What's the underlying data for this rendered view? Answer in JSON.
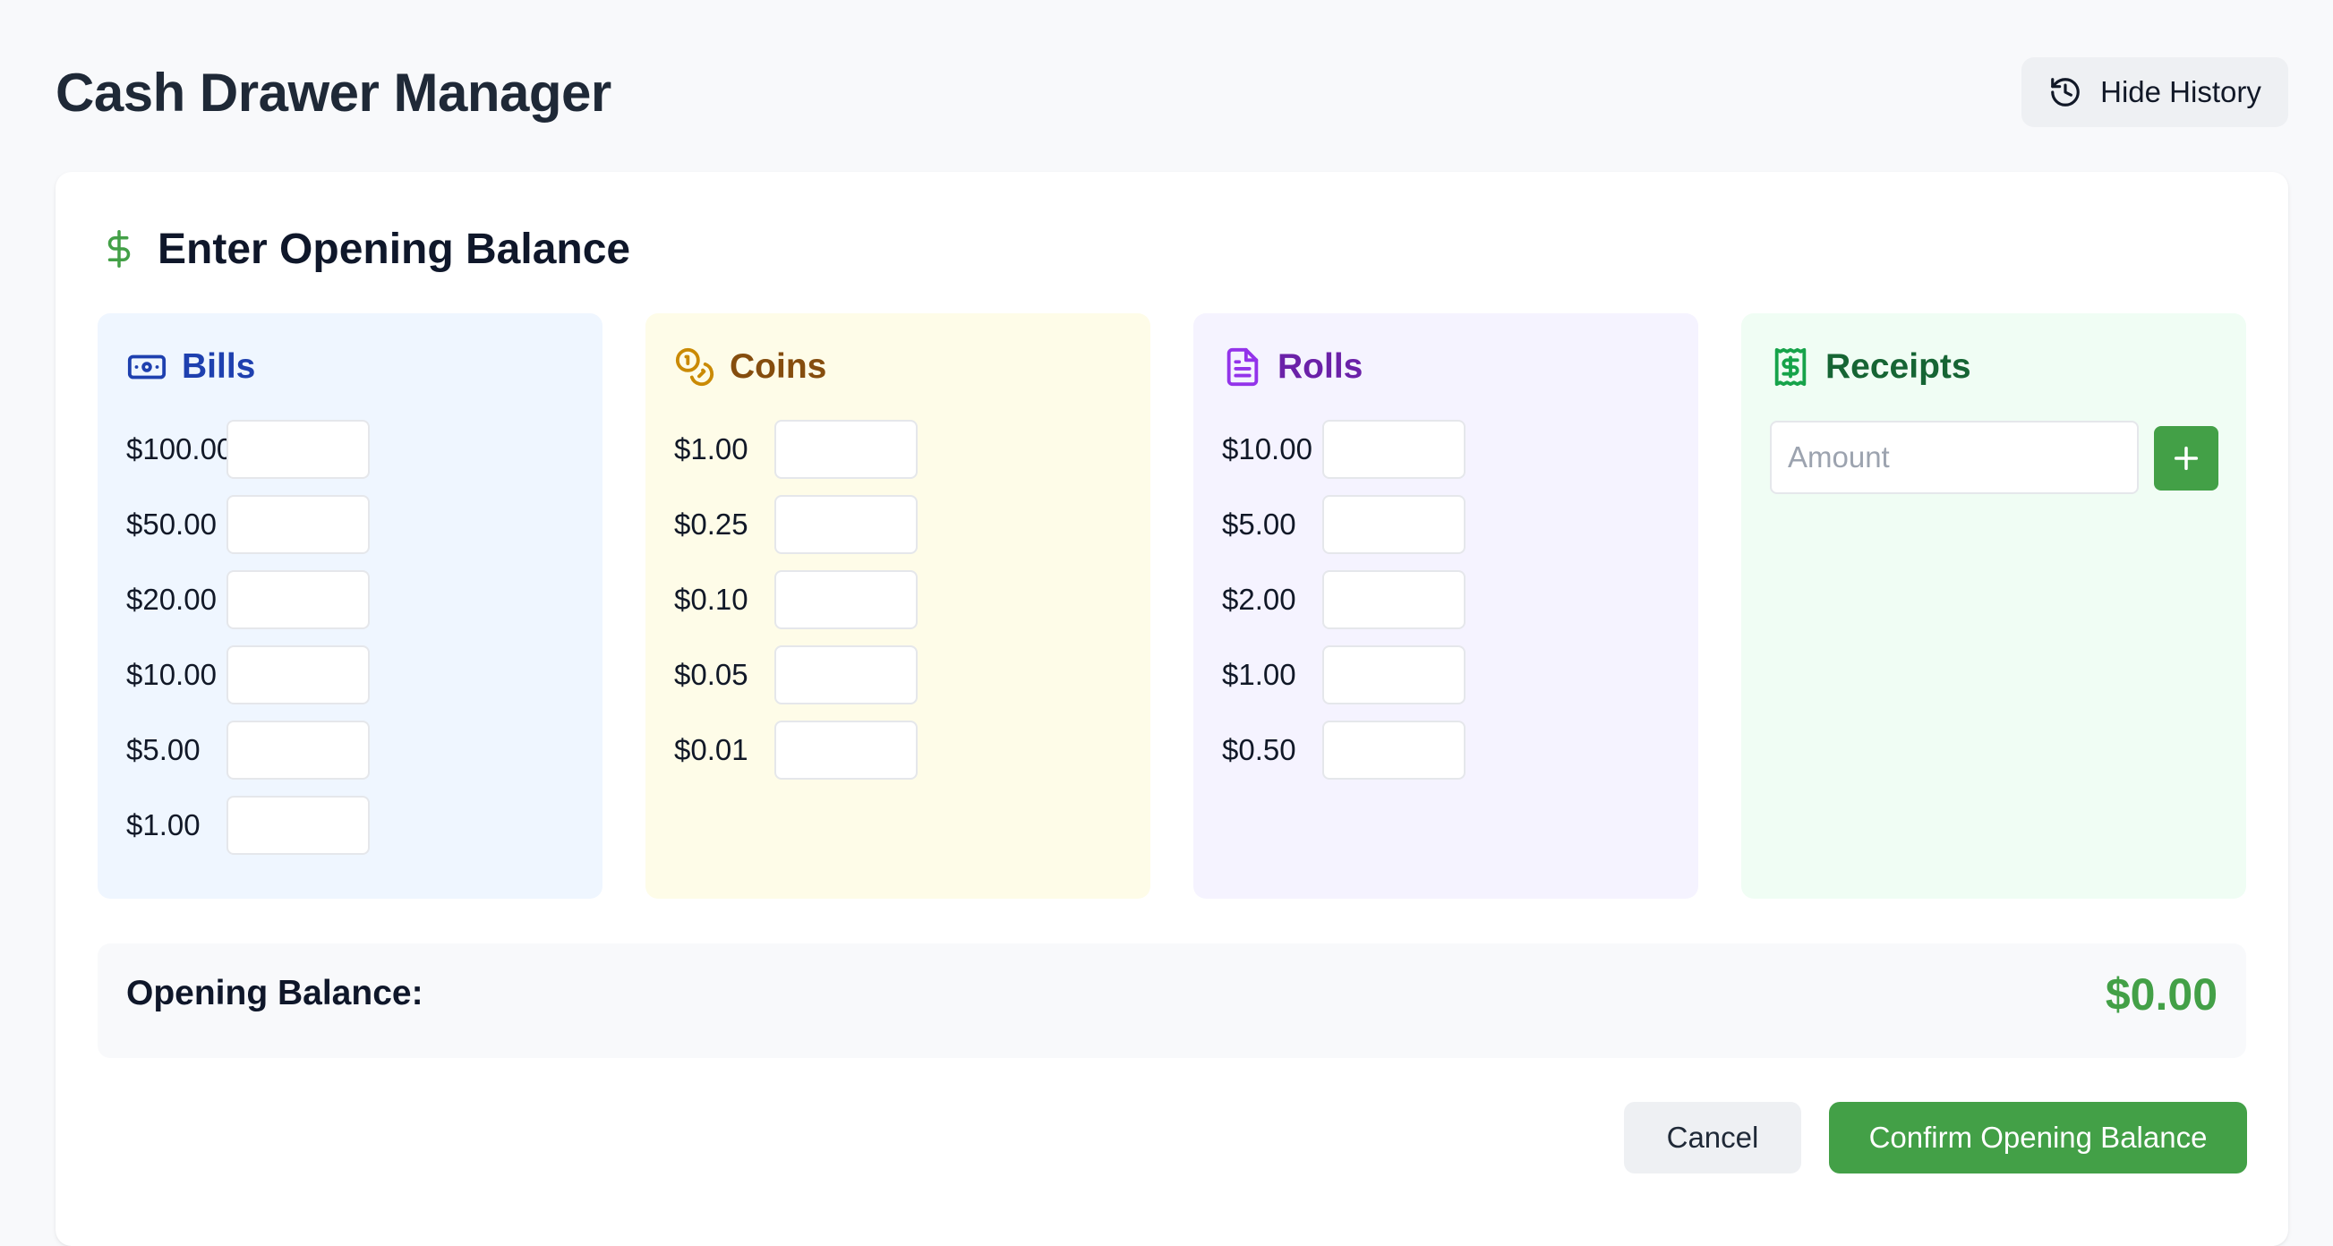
{
  "header": {
    "title": "Cash Drawer Manager",
    "history_button_label": "Hide History"
  },
  "card": {
    "title": "Enter Opening Balance",
    "bills": {
      "title": "Bills",
      "denominations": [
        "$100.00",
        "$50.00",
        "$20.00",
        "$10.00",
        "$5.00",
        "$1.00"
      ]
    },
    "coins": {
      "title": "Coins",
      "denominations": [
        "$1.00",
        "$0.25",
        "$0.10",
        "$0.05",
        "$0.01"
      ]
    },
    "rolls": {
      "title": "Rolls",
      "denominations": [
        "$10.00",
        "$5.00",
        "$2.00",
        "$1.00",
        "$0.50"
      ]
    },
    "receipts": {
      "title": "Receipts",
      "amount_placeholder": "Amount"
    },
    "opening_balance": {
      "label": "Opening Balance:",
      "value": "$0.00"
    },
    "actions": {
      "cancel_label": "Cancel",
      "confirm_label": "Confirm Opening Balance"
    }
  },
  "colors": {
    "accent_green": "#43a047",
    "bills_bg": "#eff6ff",
    "coins_bg": "#fefce8",
    "rolls_bg": "#f5f3ff",
    "receipts_bg": "#f0fdf4"
  },
  "icons": {
    "history": "history-icon",
    "dollar": "dollar-icon",
    "bills": "banknote-icon",
    "coins": "coins-icon",
    "rolls": "file-text-icon",
    "receipts": "receipt-icon",
    "add": "plus-icon"
  }
}
